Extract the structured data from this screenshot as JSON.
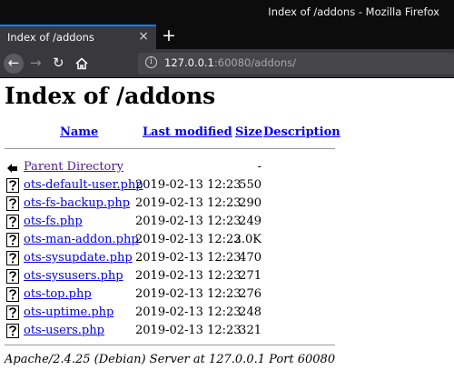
{
  "window": {
    "title": "Index of /addons - Mozilla Firefox"
  },
  "tab": {
    "label": "Index of /addons",
    "close": "×",
    "new_tab": "+"
  },
  "nav": {
    "back": "←",
    "forward": "→",
    "reload": "↻",
    "url_host": "127.0.0.1",
    "url_rest": ":60080/addons/"
  },
  "page": {
    "heading": "Index of /addons",
    "columns": {
      "name": "Name",
      "last_modified": "Last modified",
      "size": "Size",
      "description": "Description"
    },
    "parent": {
      "name": "Parent Directory",
      "size": "-"
    },
    "files": [
      {
        "name": "ots-default-user.php",
        "date": "2019-02-13 12:23",
        "size": "550"
      },
      {
        "name": "ots-fs-backup.php",
        "date": "2019-02-13 12:23",
        "size": "290"
      },
      {
        "name": "ots-fs.php",
        "date": "2019-02-13 12:23",
        "size": "249"
      },
      {
        "name": "ots-man-addon.php",
        "date": "2019-02-13 12:23",
        "size": "2.0K"
      },
      {
        "name": "ots-sysupdate.php",
        "date": "2019-02-13 12:23",
        "size": "470"
      },
      {
        "name": "ots-sysusers.php",
        "date": "2019-02-13 12:23",
        "size": "271"
      },
      {
        "name": "ots-top.php",
        "date": "2019-02-13 12:23",
        "size": "276"
      },
      {
        "name": "ots-uptime.php",
        "date": "2019-02-13 12:23",
        "size": "248"
      },
      {
        "name": "ots-users.php",
        "date": "2019-02-13 12:23",
        "size": "321"
      }
    ],
    "footer": "Apache/2.4.25 (Debian) Server at 127.0.0.1 Port 60080"
  },
  "colors": {
    "link": "#0000ee",
    "visited": "#551a8b",
    "accent": "#0a84ff"
  }
}
